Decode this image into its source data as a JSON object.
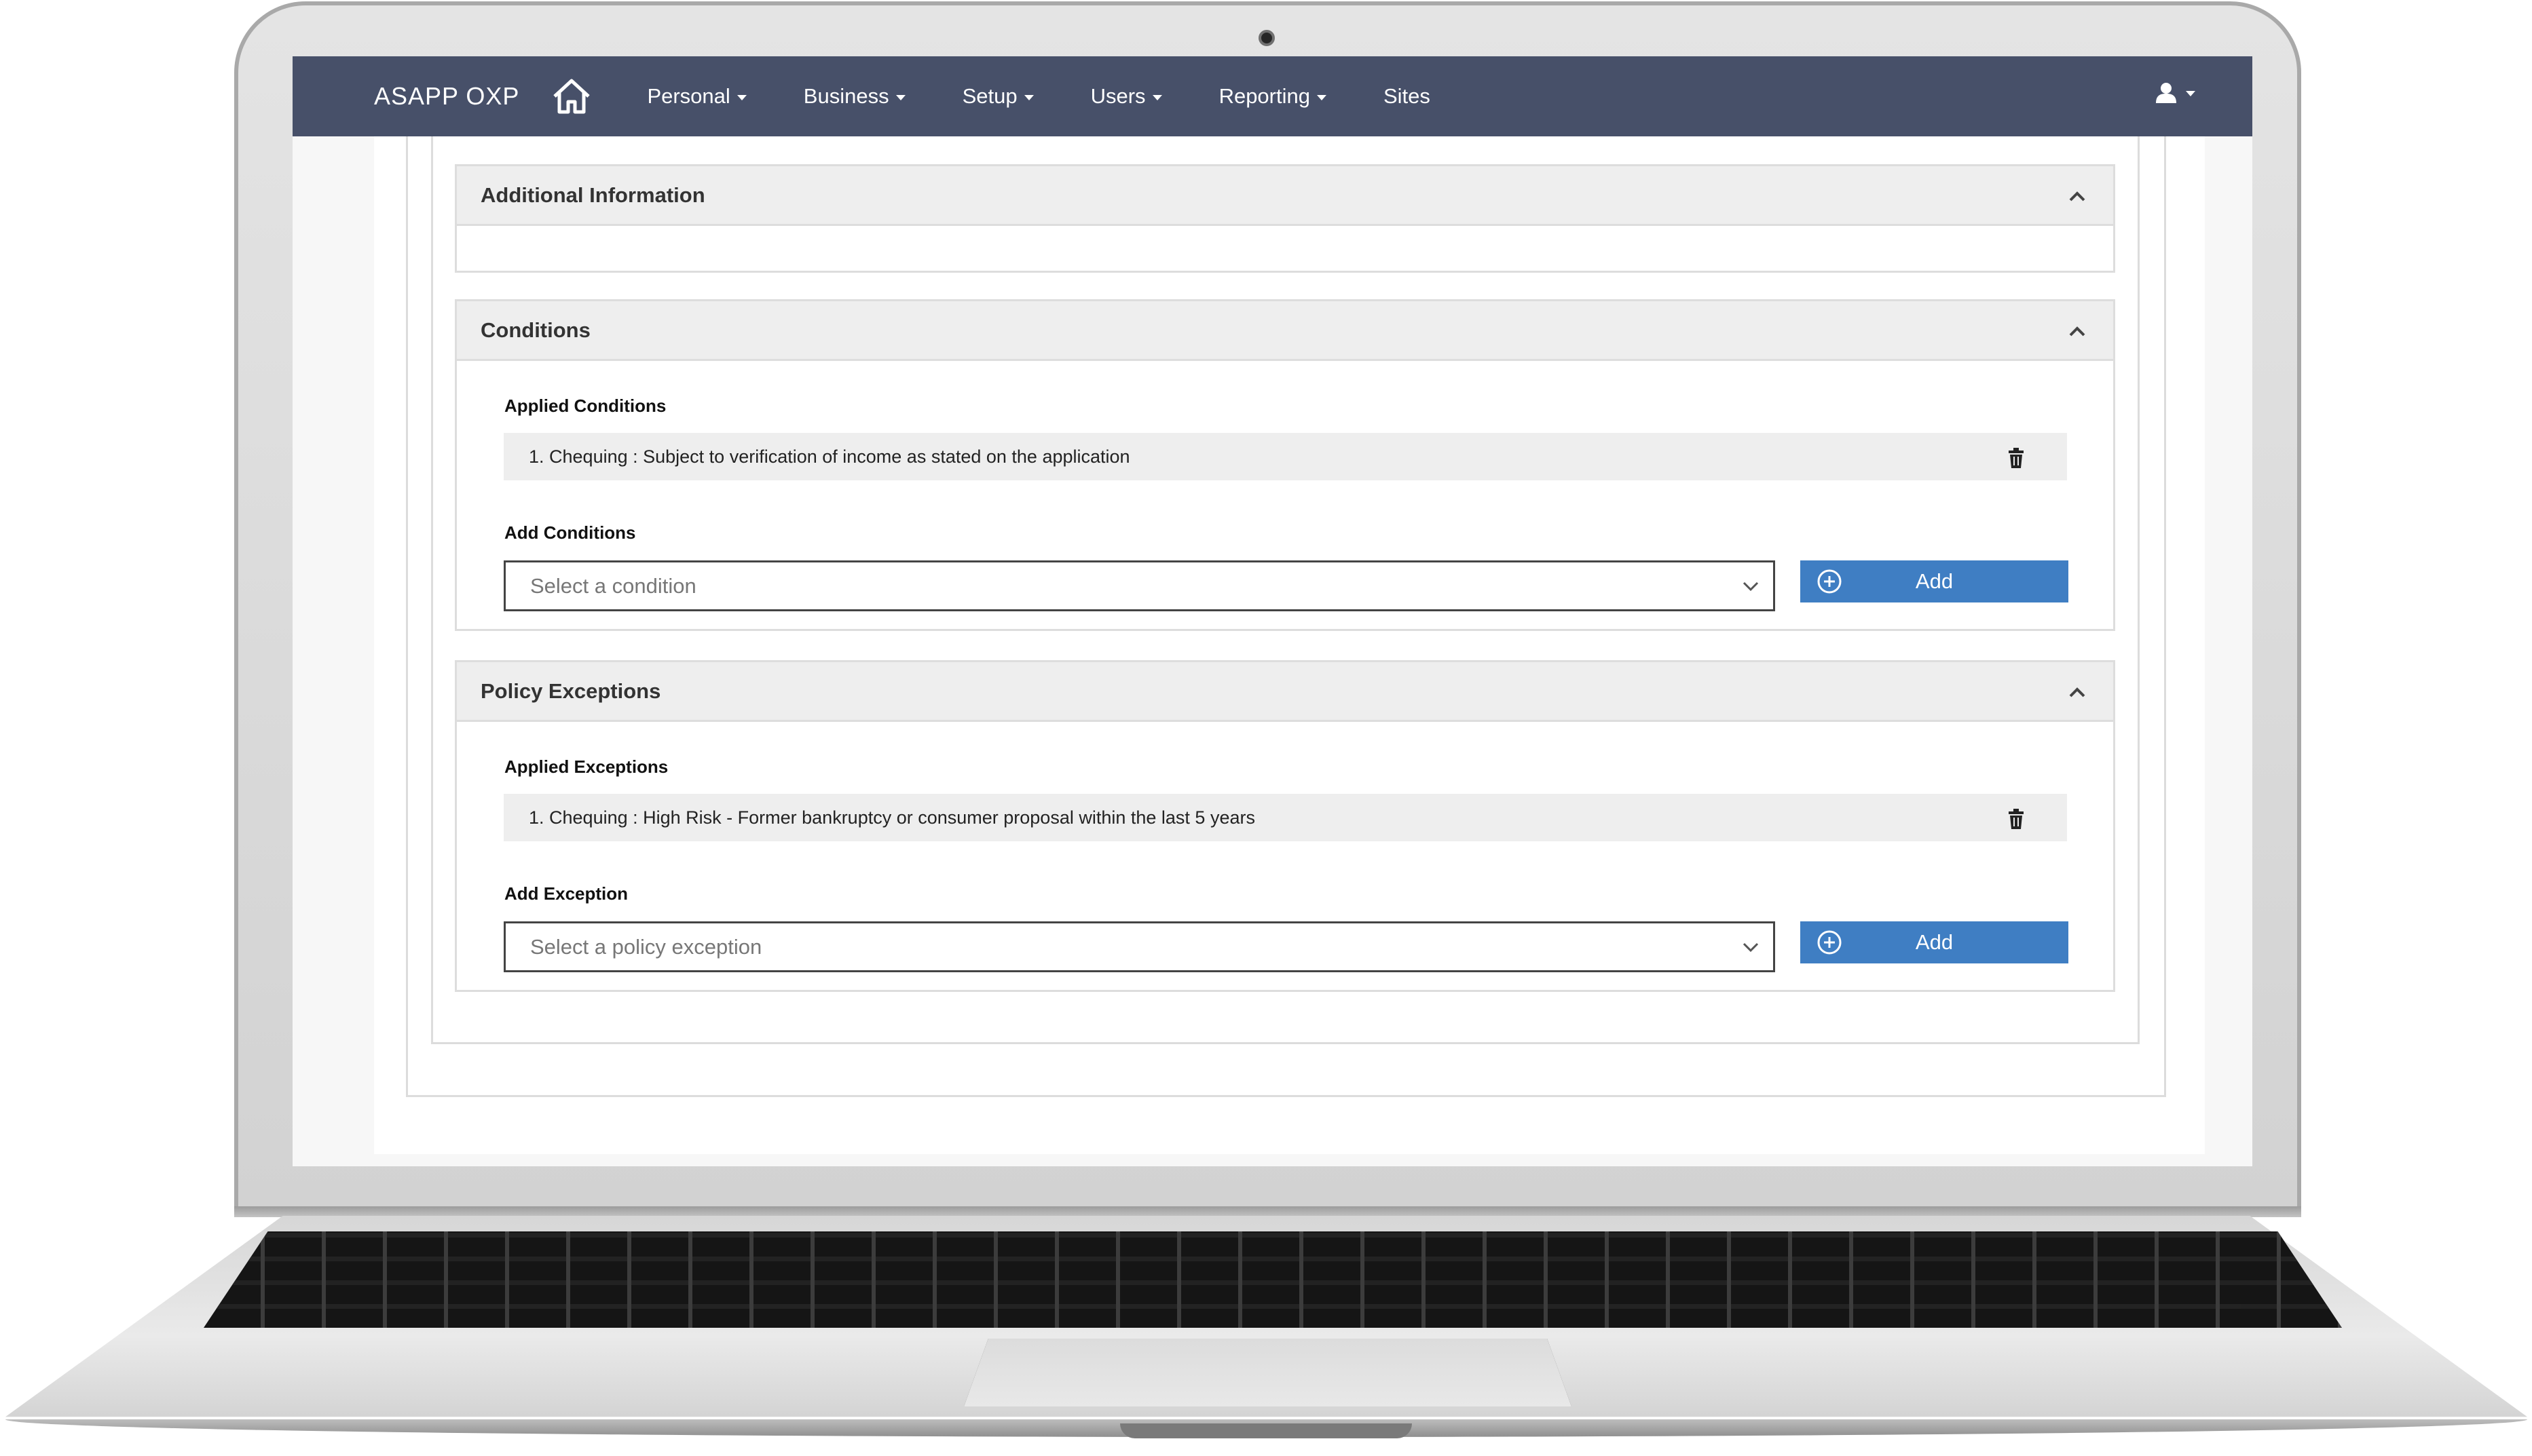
{
  "navbar": {
    "brand": "ASAPP OXP",
    "items": [
      {
        "label": "Personal",
        "dropdown": true
      },
      {
        "label": "Business",
        "dropdown": true
      },
      {
        "label": "Setup",
        "dropdown": true
      },
      {
        "label": "Users",
        "dropdown": true
      },
      {
        "label": "Reporting",
        "dropdown": true
      },
      {
        "label": "Sites",
        "dropdown": false
      }
    ],
    "icons": {
      "home": "home-icon",
      "user": "user-icon"
    }
  },
  "panels": {
    "additional_info": {
      "title": "Additional Information"
    },
    "conditions": {
      "title": "Conditions",
      "applied_label": "Applied Conditions",
      "applied": [
        "1. Chequing : Subject to verification of income as stated on the application"
      ],
      "add_label": "Add Conditions",
      "select_placeholder": "Select a condition",
      "add_button": "Add"
    },
    "exceptions": {
      "title": "Policy Exceptions",
      "applied_label": "Applied Exceptions",
      "applied": [
        "1. Chequing : High Risk - Former bankruptcy or consumer proposal within the last 5 years"
      ],
      "add_label": "Add Exception",
      "select_placeholder": "Select a policy exception",
      "add_button": "Add"
    }
  },
  "colors": {
    "navbar": "#475069",
    "primary_button": "#3f7ec3",
    "panel_header": "#eeeeee"
  }
}
